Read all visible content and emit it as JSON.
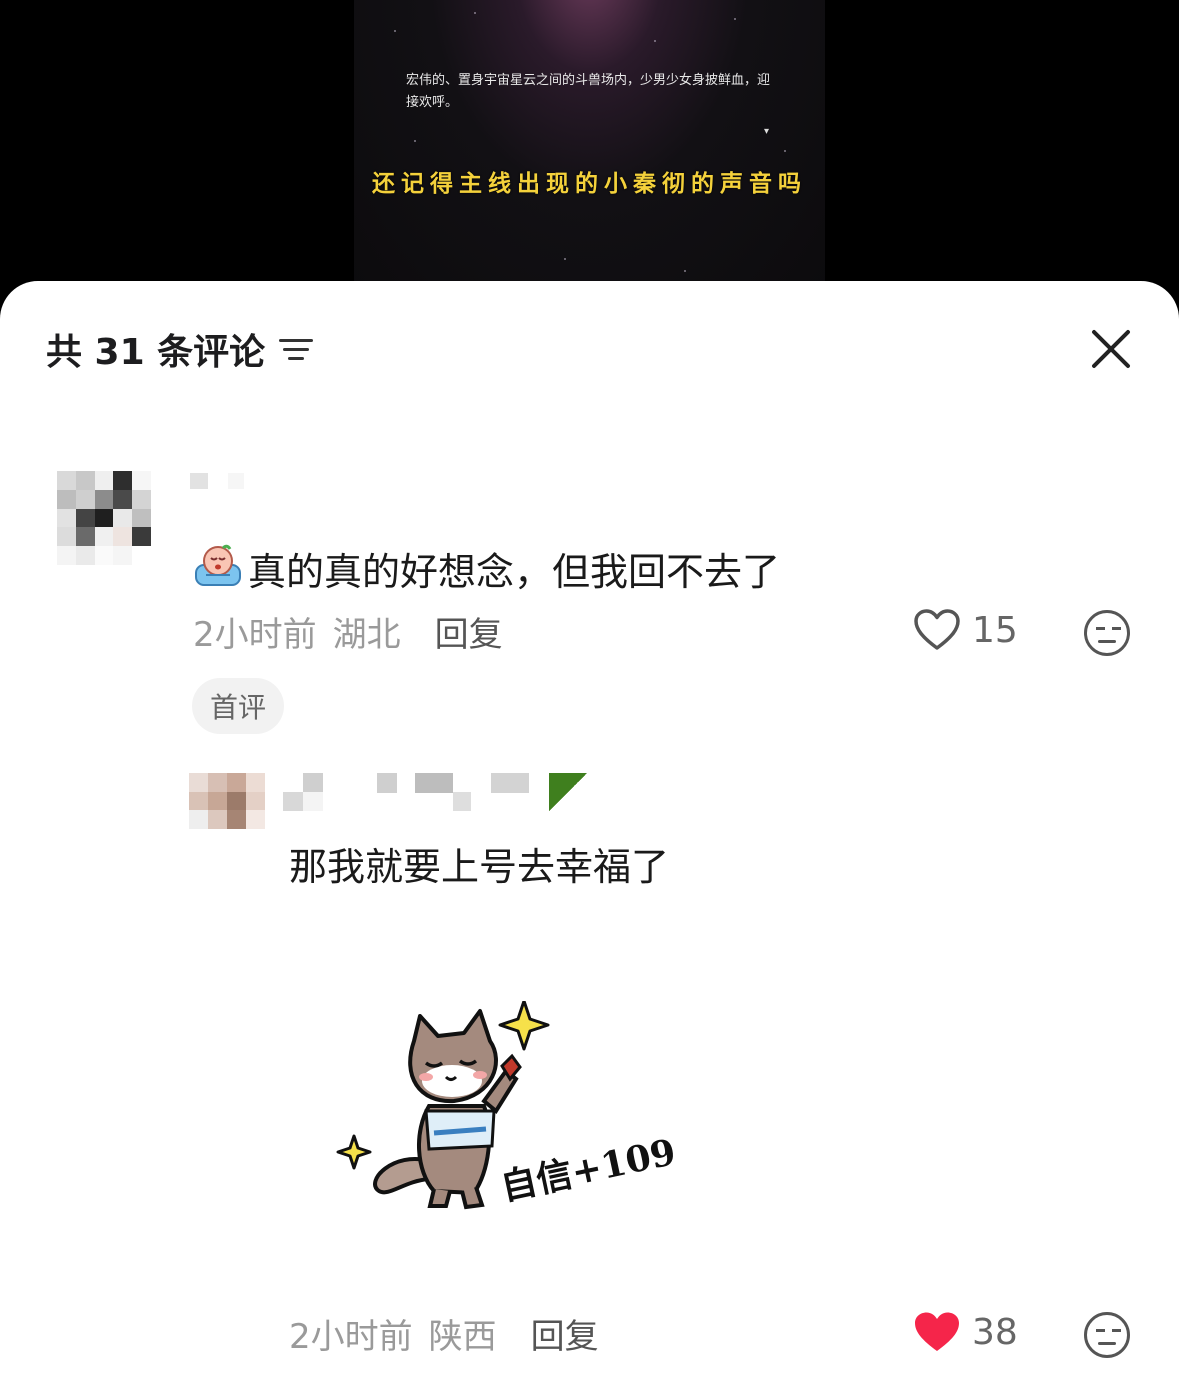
{
  "video": {
    "description": "宏伟的、置身宇宙星云之间的斗兽场内，少男少女身披鲜血，迎接欢呼。",
    "caret": "▾",
    "subtitle": "还记得主线出现的小秦彻的声音吗"
  },
  "sheet": {
    "title": "共 31 条评论",
    "filter_icon": "sort-lines-icon",
    "close_icon": "close-icon"
  },
  "comments": [
    {
      "text": "真的真的好想念，但我回不去了",
      "emoji": "crying-baby-emoji",
      "time": "2小时前",
      "location": "湖北",
      "reply_label": "回复",
      "likes": "15",
      "liked": false,
      "badge": "首评"
    },
    {
      "text": "那我就要上号去幸福了",
      "sticker": "cat-sticker",
      "sticker_caption": "自信+109",
      "time": "2小时前",
      "location": "陕西",
      "reply_label": "回复",
      "likes": "38",
      "liked": true
    }
  ],
  "colors": {
    "subtitle": "#f4d13b",
    "liked_heart": "#f5254a",
    "meta_text": "#9a9a9a"
  }
}
